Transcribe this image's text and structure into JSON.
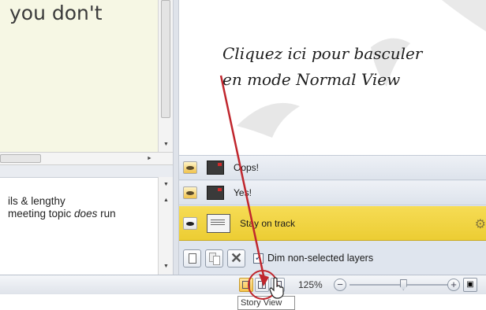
{
  "notes": {
    "text_top": "you don't",
    "lower_line1": "ils & lengthy",
    "lower_line2_prefix": "meeting topic ",
    "lower_line2_em": "does",
    "lower_line2_suffix": " run"
  },
  "annotation": {
    "line1": "Cliquez ici pour basculer",
    "line2": "en mode Normal View",
    "color": "#c0262d"
  },
  "layers": [
    {
      "label": "Oops!",
      "visible": false
    },
    {
      "label": "Yes!",
      "visible": false
    },
    {
      "label": "Stay on track",
      "visible": true,
      "active": true
    }
  ],
  "layers_toolbar": {
    "dim_label": "Dim non-selected layers",
    "dim_checked": true,
    "check_glyph": "✓"
  },
  "statusbar": {
    "zoom_label": "125%",
    "zoom_minus": "−",
    "zoom_plus": "+",
    "zoom_level_fraction": 0.55
  },
  "tooltip": {
    "text": "Story View"
  },
  "icons": {
    "gear": "⚙",
    "scroll_down": "▼",
    "scroll_up": "▲",
    "scroll_right": "►"
  }
}
